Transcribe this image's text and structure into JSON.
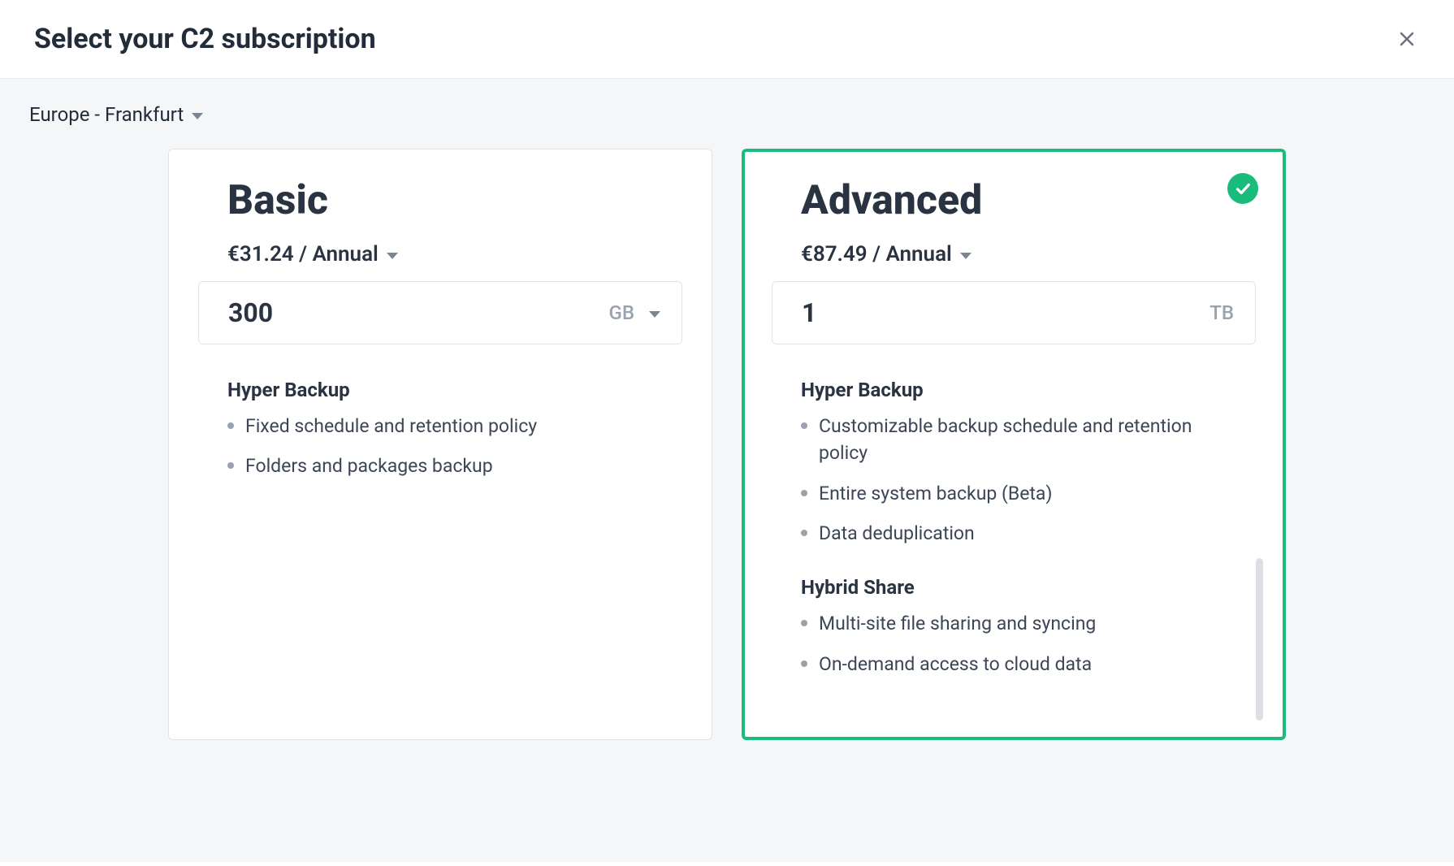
{
  "header": {
    "title": "Select your C2 subscription"
  },
  "region": {
    "label": "Europe - Frankfurt"
  },
  "plans": {
    "basic": {
      "name": "Basic",
      "price": "€31.24 / Annual",
      "size_value": "300",
      "size_unit": "GB",
      "sections": [
        {
          "title": "Hyper Backup",
          "items": [
            "Fixed schedule and retention policy",
            "Folders and packages backup"
          ]
        }
      ],
      "selected": false,
      "unit_dropdown": true
    },
    "advanced": {
      "name": "Advanced",
      "price": "€87.49 / Annual",
      "size_value": "1",
      "size_unit": "TB",
      "sections": [
        {
          "title": "Hyper Backup",
          "items": [
            "Customizable backup schedule and retention policy",
            "Entire system backup (Beta)",
            "Data deduplication"
          ]
        },
        {
          "title": "Hybrid Share",
          "items": [
            "Multi-site file sharing and syncing",
            "On-demand access to cloud data"
          ]
        }
      ],
      "selected": true,
      "unit_dropdown": false
    }
  }
}
